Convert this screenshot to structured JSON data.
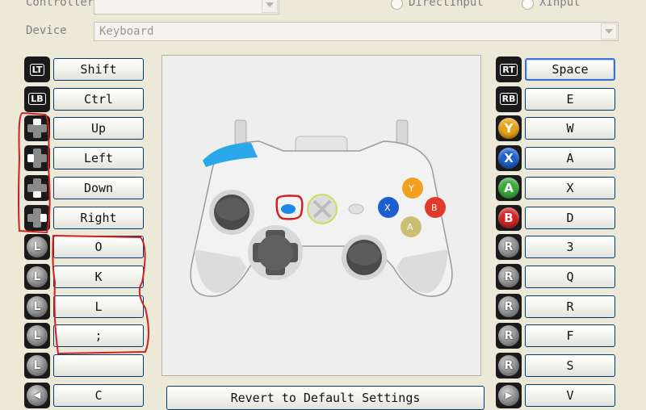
{
  "controller": {
    "label": "Controller",
    "radio_directinput": "DirectInput",
    "radio_xinput": "XInput"
  },
  "device": {
    "label": "Device",
    "value": "Keyboard"
  },
  "left_column": [
    {
      "icon": "LT",
      "icon_name": "left-trigger-icon",
      "key": "Shift"
    },
    {
      "icon": "LB",
      "icon_name": "left-bumper-icon",
      "key": "Ctrl"
    },
    {
      "icon": "",
      "icon_name": "dpad-up-icon",
      "key": "Up"
    },
    {
      "icon": "",
      "icon_name": "dpad-left-icon",
      "key": "Left"
    },
    {
      "icon": "",
      "icon_name": "dpad-down-icon",
      "key": "Down"
    },
    {
      "icon": "",
      "icon_name": "dpad-right-icon",
      "key": "Right"
    },
    {
      "icon": "L",
      "icon_name": "left-stick-up-icon",
      "key": "O"
    },
    {
      "icon": "L",
      "icon_name": "left-stick-left-icon",
      "key": "K"
    },
    {
      "icon": "L",
      "icon_name": "left-stick-down-icon",
      "key": "L"
    },
    {
      "icon": "L",
      "icon_name": "left-stick-right-icon",
      "key": ";"
    },
    {
      "icon": "L",
      "icon_name": "left-stick-click-icon",
      "key": ""
    },
    {
      "icon": "",
      "icon_name": "back-button-icon",
      "key": "C"
    }
  ],
  "right_column": [
    {
      "icon": "RT",
      "icon_name": "right-trigger-icon",
      "key": "Space"
    },
    {
      "icon": "RB",
      "icon_name": "right-bumper-icon",
      "key": "E"
    },
    {
      "icon": "Y",
      "icon_name": "y-button-icon",
      "key": "W",
      "color": "#e8a317"
    },
    {
      "icon": "X",
      "icon_name": "x-button-icon",
      "key": "A",
      "color": "#1e5fd0"
    },
    {
      "icon": "A",
      "icon_name": "a-button-icon",
      "key": "X",
      "color": "#3aa83a"
    },
    {
      "icon": "B",
      "icon_name": "b-button-icon",
      "key": "D",
      "color": "#d02424"
    },
    {
      "icon": "R",
      "icon_name": "right-stick-up-icon",
      "key": "3"
    },
    {
      "icon": "R",
      "icon_name": "right-stick-left-icon",
      "key": "Q"
    },
    {
      "icon": "R",
      "icon_name": "right-stick-down-icon",
      "key": "R"
    },
    {
      "icon": "R",
      "icon_name": "right-stick-right-icon",
      "key": "F"
    },
    {
      "icon": "R",
      "icon_name": "right-stick-click-icon",
      "key": "S"
    },
    {
      "icon": "",
      "icon_name": "start-button-icon",
      "key": "V"
    }
  ],
  "revert_button": "Revert to Default Settings",
  "colors": {
    "window_bg": "#ece9d8",
    "button_border": "#003c74",
    "annotation_red": "#d21f1f",
    "guide_button_blue": "#1e88e5"
  }
}
